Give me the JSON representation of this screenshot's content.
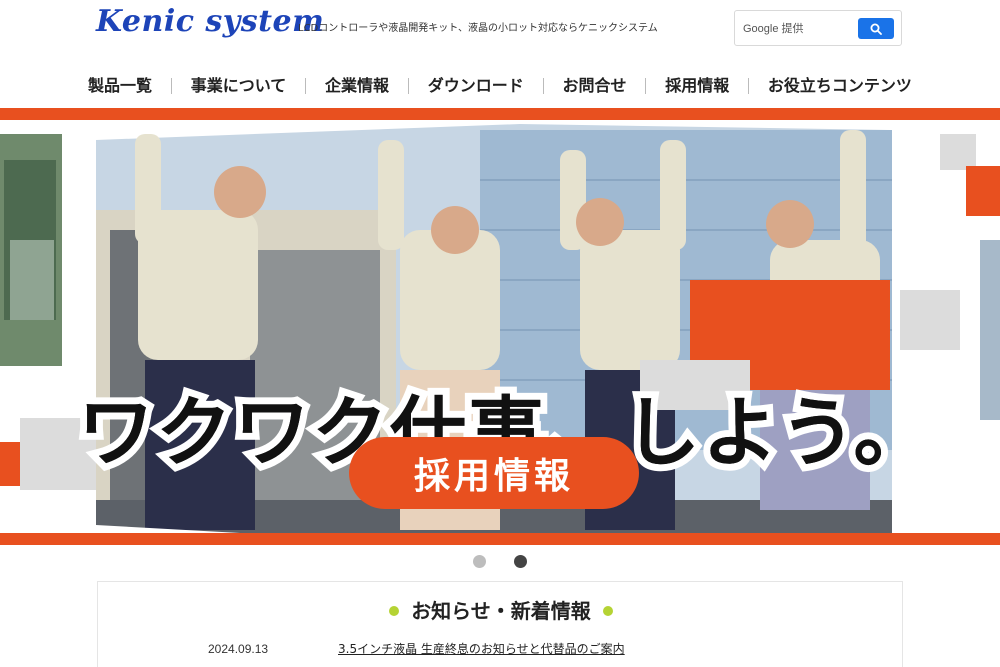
{
  "header": {
    "logo_text": "Kenic system",
    "tagline": "LCDコントローラや液晶開発キット、液晶の小ロット対応ならケニックシステム",
    "search": {
      "label": "Google 提供",
      "button_icon": "search-icon"
    }
  },
  "nav": {
    "items": [
      {
        "label": "製品一覧"
      },
      {
        "label": "事業について"
      },
      {
        "label": "企業情報"
      },
      {
        "label": "ダウンロード"
      },
      {
        "label": "お問合せ"
      },
      {
        "label": "採用情報"
      },
      {
        "label": "お役立ちコンテンツ"
      }
    ]
  },
  "hero": {
    "headline": "ワクワク仕事、しよう。",
    "cta_label": "採用情報",
    "accent_color": "#e8501f"
  },
  "carousel": {
    "slides": 2,
    "active_index": 1
  },
  "news": {
    "title": "お知らせ・新着情報",
    "bullet_color": "#b5d334",
    "items": [
      {
        "date": "2024.09.13",
        "title": "3.5インチ液晶 生産終息のお知らせと代替品のご案内"
      }
    ]
  }
}
